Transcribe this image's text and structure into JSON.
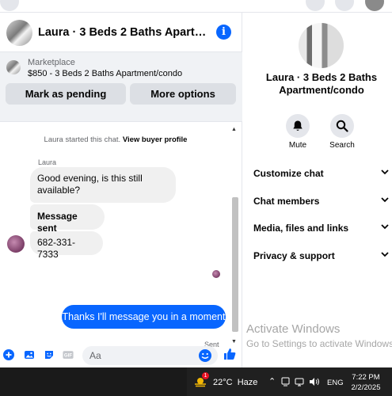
{
  "chat": {
    "header_title": "Laura · 3 Beds 2 Baths Apartment/condo",
    "marketplace": {
      "label": "Marketplace",
      "listing": "$850 - 3 Beds 2 Baths Apartment/condo",
      "mark_pending": "Mark as pending",
      "more_options": "More options"
    },
    "system_prefix": "Laura started this chat.",
    "system_link": "View buyer profile",
    "sender_name": "Laura",
    "messages": [
      {
        "from": "Laura",
        "text": "Good evening, is this still available?"
      },
      {
        "from": "Laura",
        "text": "Message sent"
      },
      {
        "from": "Laura",
        "text": "682-331-7333"
      },
      {
        "from": "me",
        "text": "Thanks I'll message you in a moment"
      }
    ],
    "sent_status": "Sent",
    "composer_placeholder": "Aa",
    "accent_color": "#0866ff"
  },
  "side": {
    "name": "Laura · 3 Beds 2 Baths Apartment/condo",
    "actions": [
      {
        "label": "Mute",
        "icon": "bell-icon"
      },
      {
        "label": "Search",
        "icon": "search-icon"
      }
    ],
    "sections": [
      {
        "label": "Customize chat"
      },
      {
        "label": "Chat members"
      },
      {
        "label": "Media, files and links"
      },
      {
        "label": "Privacy & support"
      }
    ]
  },
  "watermark": {
    "title": "Activate Windows",
    "subtitle": "Go to Settings to activate Windows."
  },
  "taskbar": {
    "weather_badge": "1",
    "temperature": "22°C",
    "condition": "Haze",
    "language": "ENG",
    "time": "7:22 PM",
    "date": "2/2/2025"
  }
}
